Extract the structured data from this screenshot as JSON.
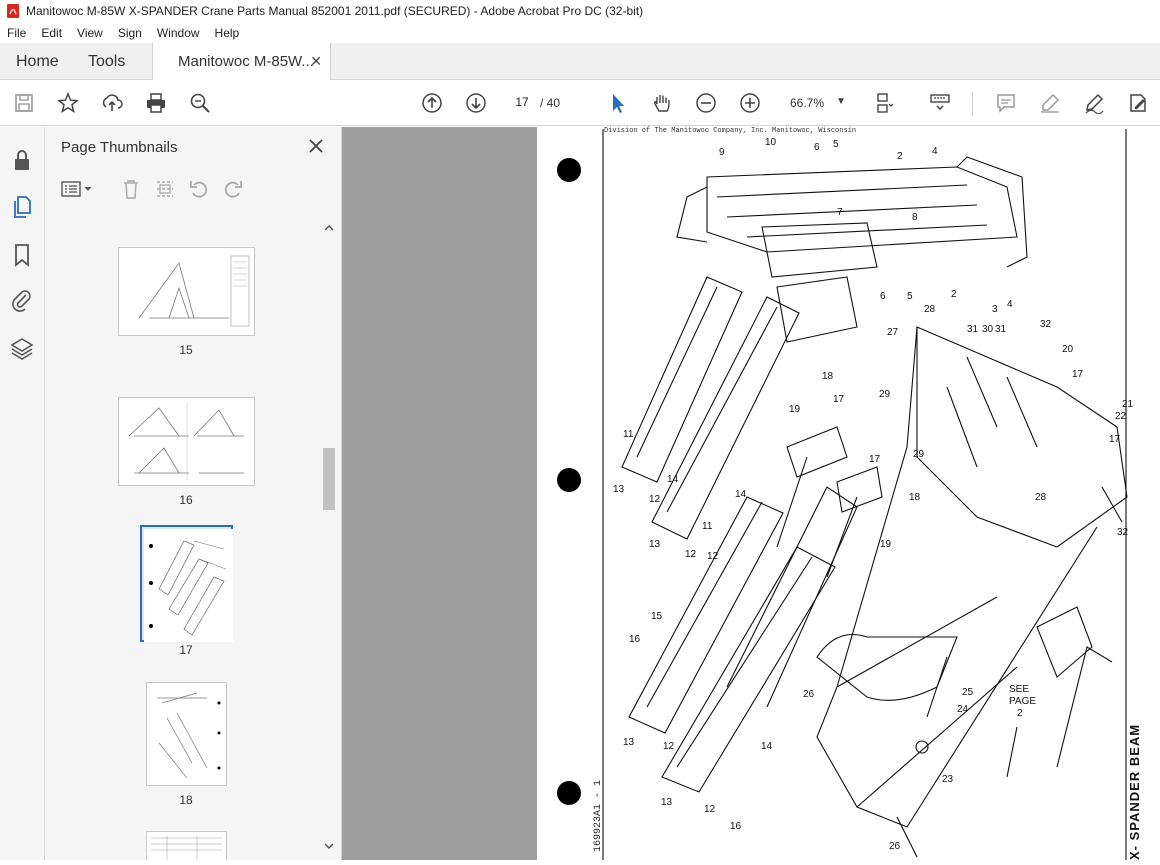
{
  "window": {
    "title": "Manitowoc M-85W X-SPANDER Crane Parts Manual 852001 2011.pdf (SECURED) - Adobe Acrobat Pro DC (32-bit)"
  },
  "menu": [
    "File",
    "Edit",
    "View",
    "Sign",
    "Window",
    "Help"
  ],
  "nav": {
    "home": "Home",
    "tools": "Tools",
    "doc_tab": "Manitowoc M-85W..."
  },
  "toolbar": {
    "current_page": "17",
    "total_pages": "/ 40",
    "zoom": "66.7%"
  },
  "thumbnails": {
    "title": "Page Thumbnails",
    "pages": [
      "15",
      "16",
      "17",
      "18"
    ],
    "selected": "17"
  },
  "document": {
    "header_strip": "Division of The Manitowoc Company, Inc.          Manitowoc, Wisconsin",
    "side_title": "X- SPANDER BEAM",
    "side_code": "169923A1 - 1",
    "see_page": [
      "SEE",
      "PAGE",
      "2"
    ],
    "callouts": [
      "9",
      "10",
      "6",
      "5",
      "2",
      "4",
      "7",
      "8",
      "6",
      "5",
      "2",
      "28",
      "3",
      "4",
      "31",
      "30",
      "31",
      "32",
      "27",
      "20",
      "17",
      "29",
      "21",
      "22",
      "17",
      "18",
      "19",
      "17",
      "29",
      "11",
      "12",
      "13",
      "14",
      "14",
      "12",
      "13",
      "17",
      "18",
      "19",
      "12",
      "11",
      "28",
      "32",
      "15",
      "16",
      "26",
      "25",
      "24",
      "13",
      "12",
      "14",
      "13",
      "12",
      "23",
      "16",
      "26"
    ]
  },
  "colors": {
    "accent": "#2a6ebb",
    "doc_bg": "#9e9e9e",
    "panel_bg": "#f5f5f5"
  }
}
